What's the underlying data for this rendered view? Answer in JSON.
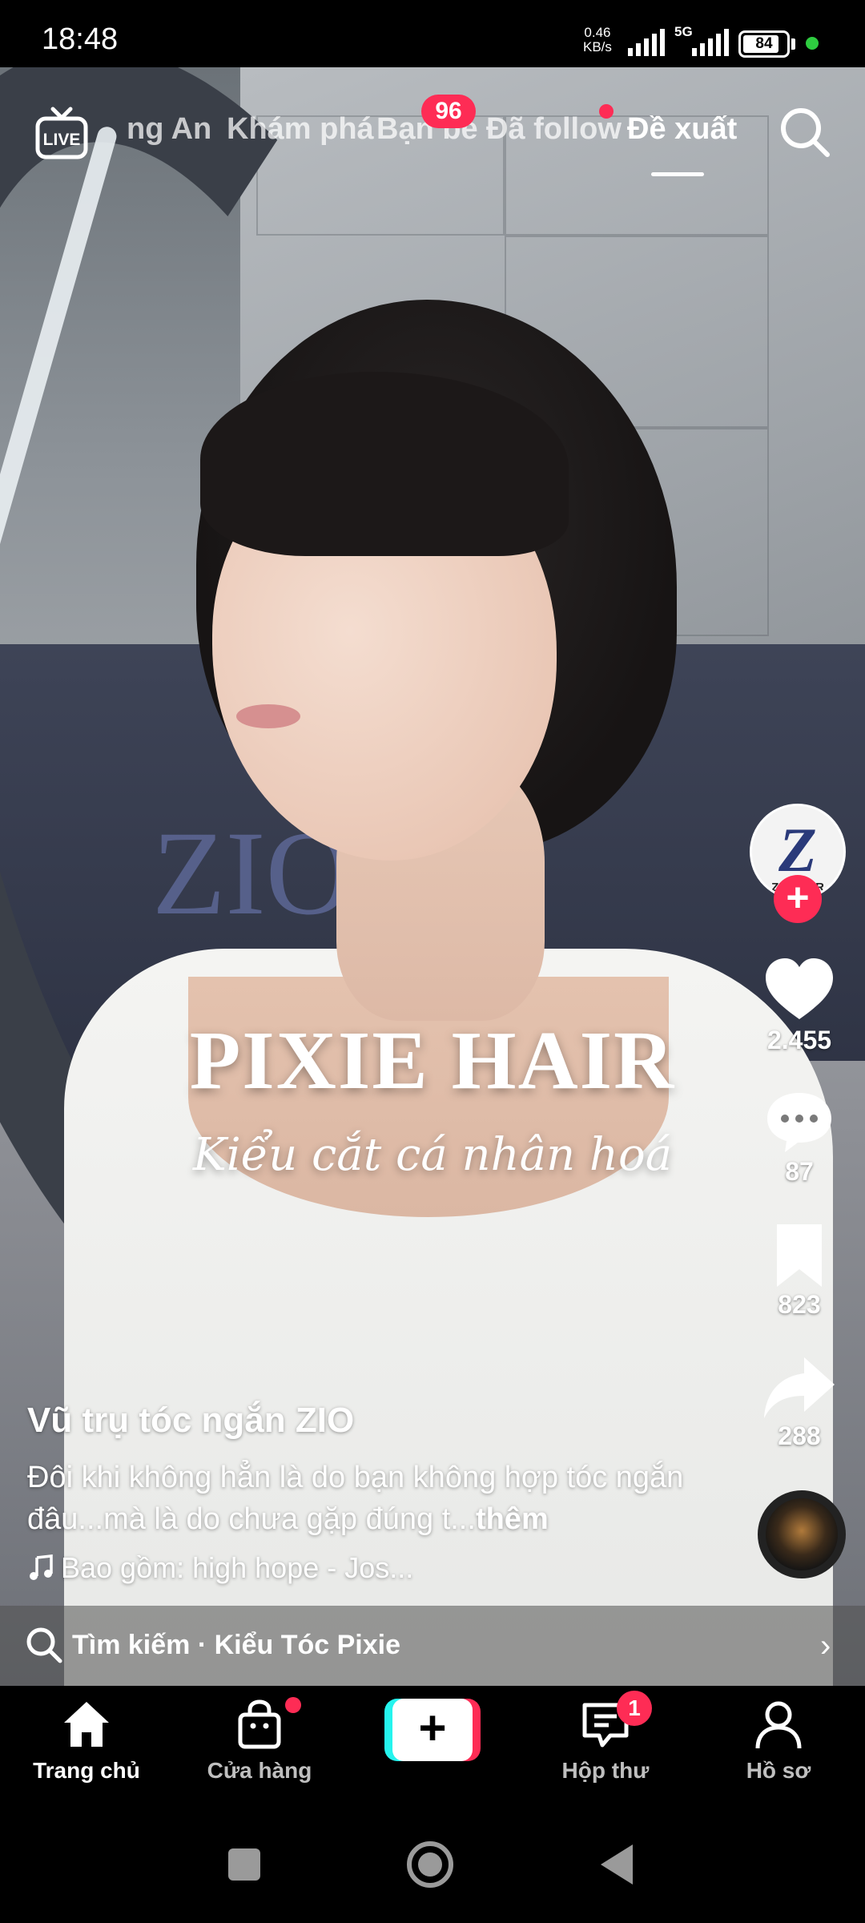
{
  "status_bar": {
    "time": "18:48",
    "net_speed_value": "0.46",
    "net_speed_unit": "KB/s",
    "network": "5G",
    "battery": "84",
    "battery_level": 0.84
  },
  "top_nav": {
    "tabs": [
      {
        "label": "ng An"
      },
      {
        "label": "Khám phá"
      },
      {
        "label": "Bạn bè"
      },
      {
        "label": "Đã follow"
      },
      {
        "label": "Đề xuất"
      }
    ],
    "friends_badge": "96",
    "active_tab": "Đề xuất"
  },
  "video": {
    "overlay_title": "PIXIE HAIR",
    "overlay_subtitle": "Kiểu cắt cá nhân hoá",
    "background_brand": "ZIO"
  },
  "creator": {
    "avatar_letter": "Z",
    "avatar_brand": "ZIO HAIR",
    "name": "Vũ trụ tóc ngắn ZIO"
  },
  "actions": {
    "likes": "2.455",
    "comments": "87",
    "saves": "823",
    "shares": "288"
  },
  "caption": {
    "text": "Đôi khi không hẳn là do bạn không hợp tóc ngắn đâu...mà là do chưa gặp đúng t...",
    "more": "thêm",
    "music": "Bao gồm: high hope - Jos..."
  },
  "search_suggestion": {
    "label": "Tìm kiếm · Kiểu Tóc Pixie"
  },
  "bottom_nav": {
    "home": "Trang chủ",
    "shop": "Cửa hàng",
    "inbox": "Hộp thư",
    "inbox_badge": "1",
    "profile": "Hồ sơ"
  },
  "colors": {
    "accent": "#fe2c55",
    "cyan": "#25f4ee",
    "status_green": "#2ecc40"
  },
  "icons": [
    "live-icon",
    "search-icon",
    "heart-icon",
    "comment-icon",
    "bookmark-icon",
    "share-icon",
    "music-note-icon",
    "home-icon",
    "shopping-bag-icon",
    "inbox-icon",
    "profile-icon"
  ]
}
